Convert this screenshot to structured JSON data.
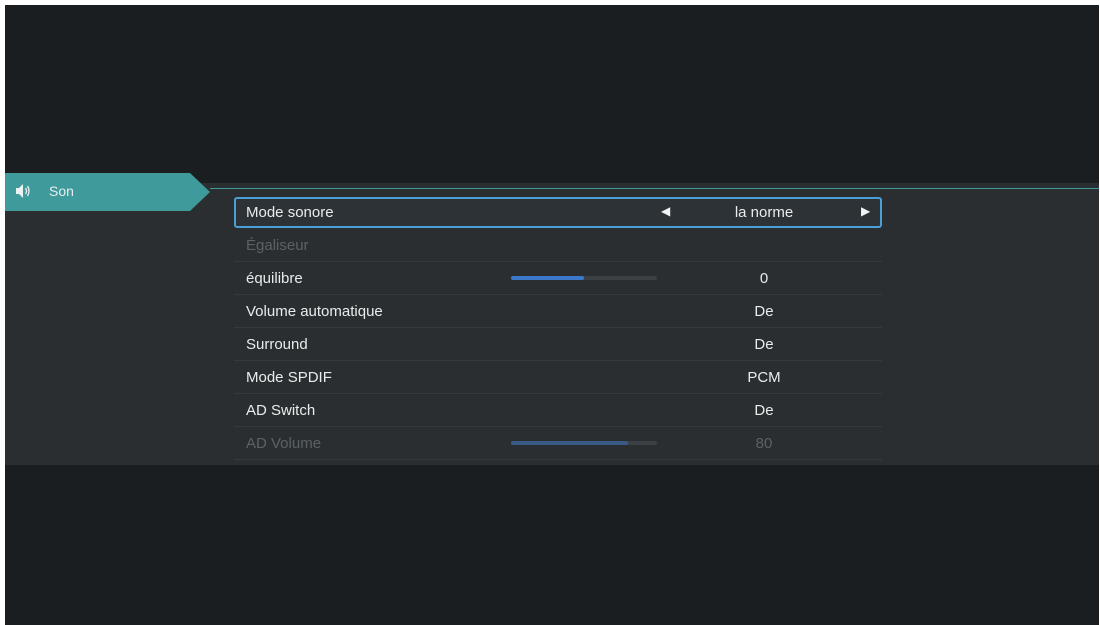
{
  "tab": {
    "label": "Son",
    "icon": "speaker-icon"
  },
  "menu": {
    "rows": [
      {
        "label": "Mode sonore",
        "value": "la norme",
        "selected": true
      },
      {
        "label": "Égaliseur",
        "value": "",
        "disabled": true
      },
      {
        "label": "équilibre",
        "value": "0",
        "slider": 0.5
      },
      {
        "label": "Volume automatique",
        "value": "De"
      },
      {
        "label": "Surround",
        "value": "De"
      },
      {
        "label": "Mode SPDIF",
        "value": "PCM"
      },
      {
        "label": "AD Switch",
        "value": "De"
      },
      {
        "label": "AD Volume",
        "value": "80",
        "slider": 0.8,
        "disabled": true
      }
    ]
  },
  "colors": {
    "accent_teal": "#3e9a9b",
    "selection_border": "#4b9fd7",
    "slider_fill": "#3c78c9"
  }
}
